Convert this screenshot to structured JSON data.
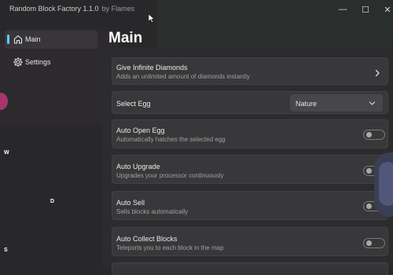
{
  "window": {
    "title": "Random Block Factory 1.1.0",
    "subtitle": "by Flames",
    "controls": {
      "minimize": "—",
      "maximize": "☐",
      "close": "✕"
    }
  },
  "sidebar": {
    "items": [
      {
        "label": "Main",
        "icon": "home-icon",
        "active": true
      },
      {
        "label": "Settings",
        "icon": "gear-icon",
        "active": false
      }
    ],
    "overlay_letters": [
      "W",
      "D",
      "S"
    ]
  },
  "main": {
    "title": "Main",
    "cards": [
      {
        "type": "button",
        "title": "Give Infinite Diamonds",
        "description": "Adds an unlimited amount of diamonds instantly"
      },
      {
        "type": "dropdown",
        "title": "Select Egg",
        "value": "Nature"
      },
      {
        "type": "toggle",
        "title": "Auto Open Egg",
        "description": "Automatically hatches the selected egg",
        "on": false
      },
      {
        "type": "toggle",
        "title": "Auto Upgrade",
        "description": "Upgrades your processor continuously",
        "on": false
      },
      {
        "type": "toggle",
        "title": "Auto Sell",
        "description": "Sells blocks automatically",
        "on": false
      },
      {
        "type": "toggle",
        "title": "Auto Collect Blocks",
        "description": "Teleports you to each block in the map",
        "on": false
      }
    ]
  },
  "colors": {
    "accent": "#60cdff",
    "window_bg": "#2b2b2d",
    "toggle_off": "#a9a9a9"
  }
}
